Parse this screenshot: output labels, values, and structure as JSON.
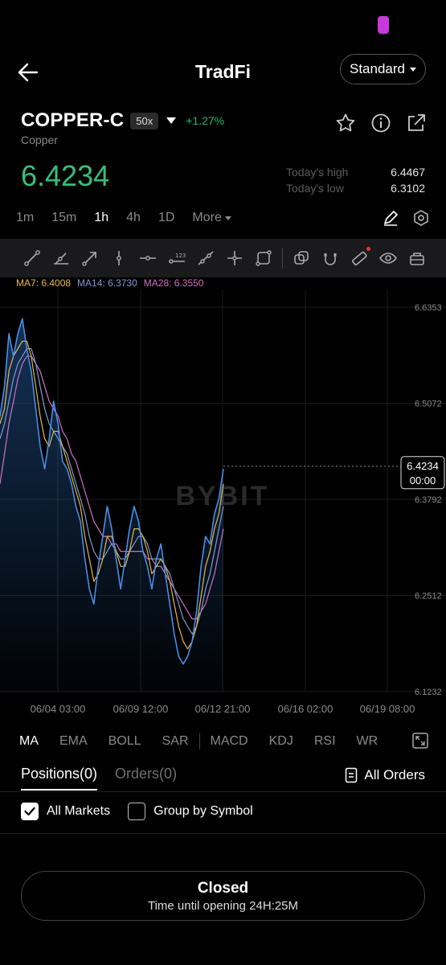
{
  "header": {
    "title": "TradFi",
    "mode_label": "Standard"
  },
  "instrument": {
    "symbol": "COPPER-C",
    "leverage": "50x",
    "change": "+1.27%",
    "name": "Copper",
    "last_price": "6.4234",
    "high_label": "Today's high",
    "high_value": "6.4467",
    "low_label": "Today's low",
    "low_value": "6.3102"
  },
  "timeframes": [
    "1m",
    "15m",
    "1h",
    "4h",
    "1D"
  ],
  "timeframe_active": "1h",
  "timeframe_more": "More",
  "ma_legend": {
    "ma7": "MA7: 6.4008",
    "ma14": "MA14: 6.3730",
    "ma28": "MA28: 6.3550"
  },
  "colors": {
    "up": "#28b773",
    "price": "#36c07c",
    "ma7": "#e8b84a",
    "ma14": "#7d9bd6",
    "ma28": "#d070c4",
    "price_line": "#4a8ee6"
  },
  "chart_data": {
    "type": "line",
    "y_ticks": [
      "6.6353",
      "6.5072",
      "6.3792",
      "6.2512",
      "6.1232"
    ],
    "ylim": [
      6.1232,
      6.6353
    ],
    "x_ticks": [
      "06/04 03:00",
      "06/09 12:00",
      "06/12 21:00",
      "06/16 02:00",
      "06/19 08:00"
    ],
    "watermark": "BYBIT",
    "last_price_tag": "6.4234",
    "countdown_tag": "00:00",
    "series": [
      {
        "name": "close",
        "values": [
          6.49,
          6.53,
          6.6,
          6.57,
          6.6,
          6.62,
          6.58,
          6.55,
          6.5,
          6.45,
          6.42,
          6.46,
          6.51,
          6.48,
          6.43,
          6.42,
          6.4,
          6.37,
          6.35,
          6.3,
          6.26,
          6.24,
          6.29,
          6.33,
          6.37,
          6.34,
          6.3,
          6.26,
          6.3,
          6.34,
          6.37,
          6.35,
          6.31,
          6.29,
          6.26,
          6.3,
          6.32,
          6.28,
          6.24,
          6.2,
          6.17,
          6.16,
          6.17,
          6.19,
          6.23,
          6.29,
          6.33,
          6.32,
          6.36,
          6.38,
          6.42
        ]
      },
      {
        "name": "MA7",
        "values": [
          6.48,
          6.5,
          6.55,
          6.57,
          6.58,
          6.59,
          6.59,
          6.57,
          6.53,
          6.49,
          6.46,
          6.45,
          6.47,
          6.47,
          6.45,
          6.43,
          6.41,
          6.39,
          6.37,
          6.33,
          6.3,
          6.27,
          6.28,
          6.3,
          6.33,
          6.33,
          6.31,
          6.29,
          6.29,
          6.31,
          6.34,
          6.34,
          6.33,
          6.31,
          6.28,
          6.29,
          6.3,
          6.29,
          6.27,
          6.24,
          6.21,
          6.19,
          6.18,
          6.19,
          6.21,
          6.25,
          6.29,
          6.31,
          6.34,
          6.36,
          6.4
        ]
      },
      {
        "name": "MA14",
        "values": [
          6.46,
          6.48,
          6.51,
          6.54,
          6.56,
          6.57,
          6.58,
          6.58,
          6.56,
          6.53,
          6.5,
          6.48,
          6.47,
          6.46,
          6.45,
          6.44,
          6.42,
          6.4,
          6.38,
          6.36,
          6.33,
          6.31,
          6.3,
          6.3,
          6.31,
          6.32,
          6.31,
          6.3,
          6.3,
          6.31,
          6.32,
          6.33,
          6.33,
          6.32,
          6.3,
          6.3,
          6.3,
          6.29,
          6.28,
          6.26,
          6.24,
          6.22,
          6.21,
          6.2,
          6.21,
          6.23,
          6.26,
          6.28,
          6.31,
          6.34,
          6.37
        ]
      },
      {
        "name": "MA28",
        "values": [
          6.4,
          6.44,
          6.48,
          6.51,
          6.54,
          6.56,
          6.57,
          6.57,
          6.56,
          6.55,
          6.53,
          6.51,
          6.5,
          6.49,
          6.47,
          6.46,
          6.44,
          6.43,
          6.41,
          6.39,
          6.37,
          6.35,
          6.34,
          6.33,
          6.33,
          6.32,
          6.32,
          6.31,
          6.31,
          6.31,
          6.31,
          6.31,
          6.31,
          6.3,
          6.3,
          6.29,
          6.29,
          6.28,
          6.27,
          6.26,
          6.25,
          6.24,
          6.23,
          6.22,
          6.22,
          6.23,
          6.24,
          6.26,
          6.28,
          6.31,
          6.34
        ]
      }
    ]
  },
  "indicators": [
    "MA",
    "EMA",
    "BOLL",
    "SAR",
    "MACD",
    "KDJ",
    "RSI",
    "WR"
  ],
  "indicator_active": "MA",
  "positions": {
    "tab_positions": "Positions(0)",
    "tab_orders": "Orders(0)",
    "all_orders": "All Orders",
    "filter_all_markets": "All Markets",
    "filter_group": "Group by Symbol"
  },
  "market_status": {
    "title": "Closed",
    "subtitle": "Time until opening 24H:25M"
  }
}
